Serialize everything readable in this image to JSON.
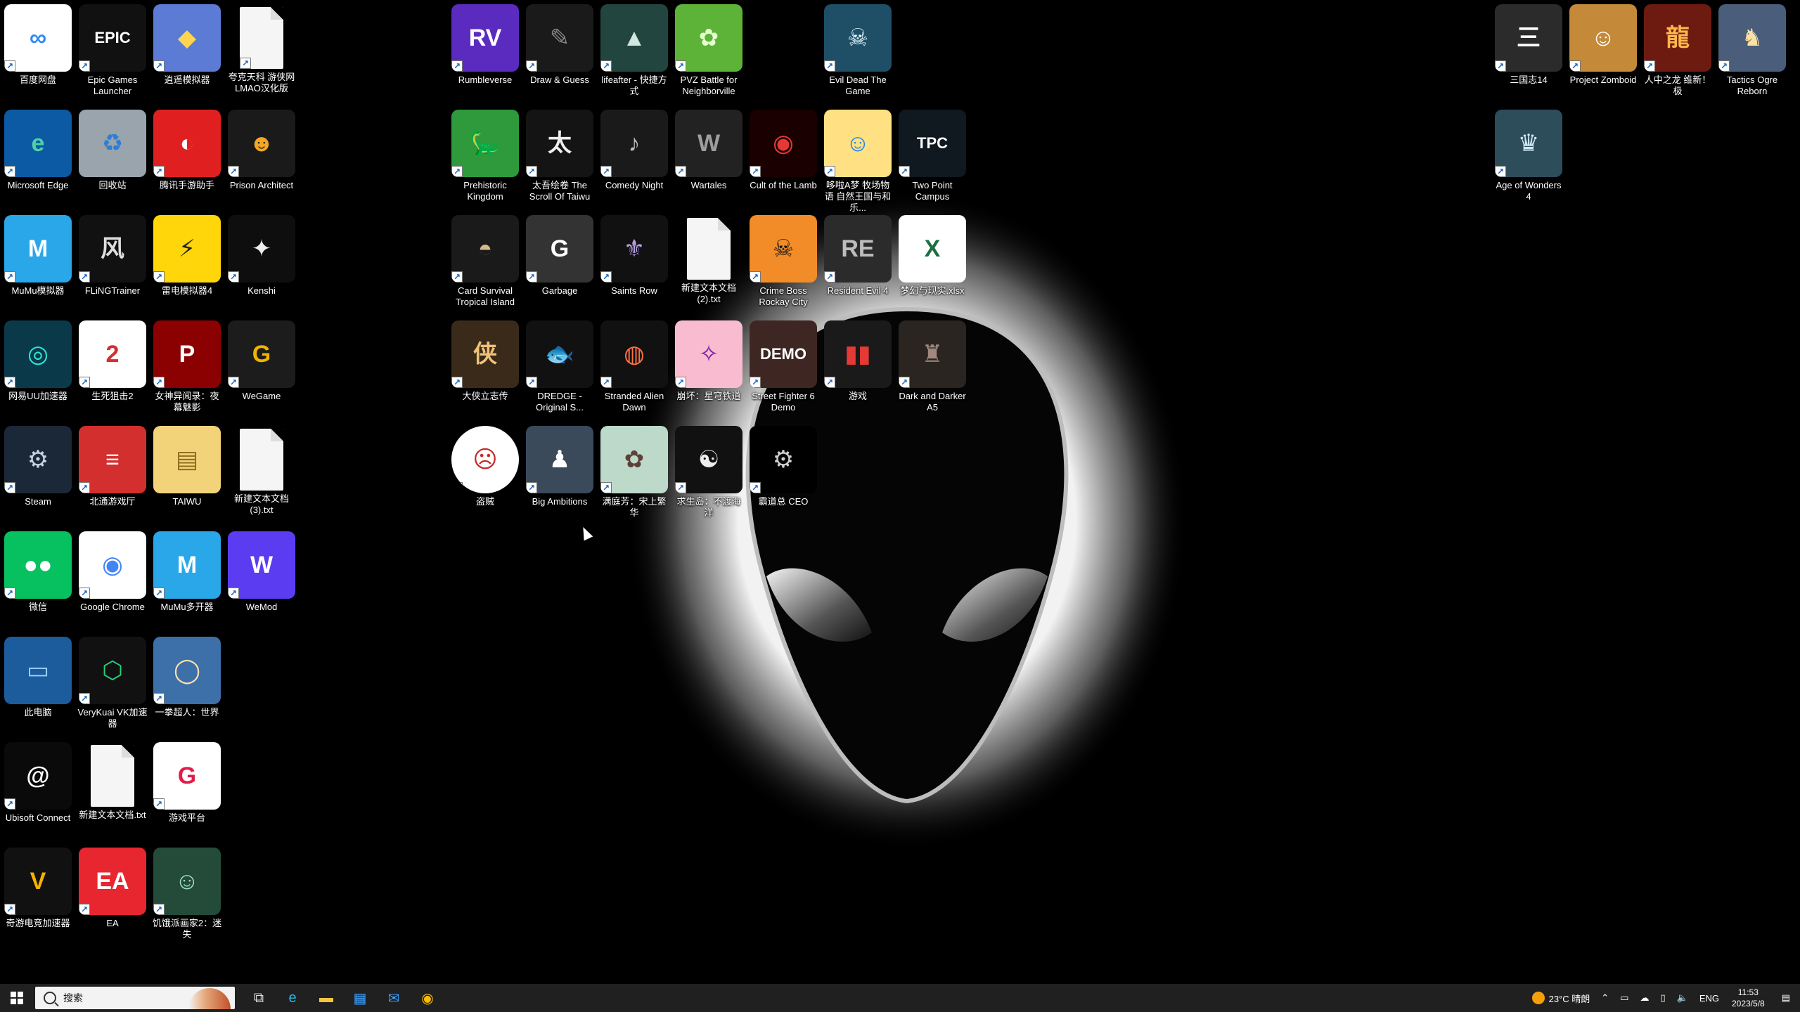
{
  "colors": {
    "taskbar": "#202020",
    "desktop_background": "#000000"
  },
  "desktop": {
    "icons": [
      {
        "label": "百度网盘",
        "icon": "baidu-netdisk-icon",
        "bg": "#ffffff",
        "fg": "#2f8cf5",
        "glyph": "∞",
        "col": 0,
        "row": 0,
        "shortcut": true
      },
      {
        "label": "Epic Games Launcher",
        "icon": "epic-games-icon",
        "bg": "#111111",
        "fg": "#ffffff",
        "glyph": "EPIC",
        "col": 1,
        "row": 0,
        "shortcut": true
      },
      {
        "label": "逍遥模拟器",
        "icon": "xiaoyao-emulator-icon",
        "bg": "#5b7bd5",
        "fg": "#ffd54f",
        "glyph": "◆",
        "col": 2,
        "row": 0,
        "shortcut": true
      },
      {
        "label": "夸克天科 游侠网LMAO汉化版",
        "icon": "document-icon",
        "bg": "doc",
        "fg": "#333333",
        "glyph": "",
        "col": 3,
        "row": 0,
        "shortcut": true
      },
      {
        "label": "Microsoft Edge",
        "icon": "edge-icon",
        "bg": "#0c59a4",
        "fg": "#4fd1a5",
        "glyph": "e",
        "col": 0,
        "row": 1,
        "shortcut": true
      },
      {
        "label": "回收站",
        "icon": "recycle-bin-icon",
        "bg": "#9aa4ad",
        "fg": "#2e7dd1",
        "glyph": "♻",
        "col": 1,
        "row": 1,
        "shortcut": false
      },
      {
        "label": "腾讯手游助手",
        "icon": "tencent-mobile-assistant-icon",
        "bg": "#e02020",
        "fg": "#ffffff",
        "glyph": "◐",
        "col": 2,
        "row": 1,
        "shortcut": true
      },
      {
        "label": "Prison Architect",
        "icon": "prison-architect-icon",
        "bg": "#1a1a1a",
        "fg": "#f5a623",
        "glyph": "☻",
        "col": 3,
        "row": 1,
        "shortcut": true
      },
      {
        "label": "MuMu模拟器",
        "icon": "mumu-emulator-icon",
        "bg": "#2aa7e8",
        "fg": "#ffffff",
        "glyph": "M",
        "col": 0,
        "row": 2,
        "shortcut": true
      },
      {
        "label": "FLiNGTrainer",
        "icon": "fling-trainer-icon",
        "bg": "#111111",
        "fg": "#dddddd",
        "glyph": "风",
        "col": 1,
        "row": 2,
        "shortcut": true
      },
      {
        "label": "雷电模拟器4",
        "icon": "ldplayer-icon",
        "bg": "#ffd60a",
        "fg": "#222222",
        "glyph": "⚡",
        "col": 2,
        "row": 2,
        "shortcut": true
      },
      {
        "label": "Kenshi",
        "icon": "kenshi-icon",
        "bg": "#0e0e0e",
        "fg": "#eeeeee",
        "glyph": "✦",
        "col": 3,
        "row": 2,
        "shortcut": true
      },
      {
        "label": "网易UU加速器",
        "icon": "uu-accelerator-icon",
        "bg": "#0a3a4a",
        "fg": "#2ee6d6",
        "glyph": "◎",
        "col": 0,
        "row": 3,
        "shortcut": true
      },
      {
        "label": "生死狙击2",
        "icon": "game-icon",
        "bg": "#ffffff",
        "fg": "#d32f2f",
        "glyph": "2",
        "col": 1,
        "row": 3,
        "shortcut": true
      },
      {
        "label": "女神异闻录：夜幕魅影",
        "icon": "persona-icon",
        "bg": "#8b0000",
        "fg": "#ffffff",
        "glyph": "P",
        "col": 2,
        "row": 3,
        "shortcut": true
      },
      {
        "label": "WeGame",
        "icon": "wegame-icon",
        "bg": "#1c1c1c",
        "fg": "#f0b400",
        "glyph": "G",
        "col": 3,
        "row": 3,
        "shortcut": true
      },
      {
        "label": "Steam",
        "icon": "steam-icon",
        "bg": "#1b2838",
        "fg": "#c7d5e0",
        "glyph": "⚙",
        "col": 0,
        "row": 4,
        "shortcut": true
      },
      {
        "label": "北通游戏厅",
        "icon": "game-hall-icon",
        "bg": "#d32f2f",
        "fg": "#ffffff",
        "glyph": "≡",
        "col": 1,
        "row": 4,
        "shortcut": true
      },
      {
        "label": "TAIWU",
        "icon": "folder-icon",
        "bg": "#f2d37a",
        "fg": "#8a6d1d",
        "glyph": "▤",
        "col": 2,
        "row": 4,
        "shortcut": false
      },
      {
        "label": "新建文本文档 (3).txt",
        "icon": "text-file-icon",
        "bg": "doc",
        "fg": "#333333",
        "glyph": "",
        "col": 3,
        "row": 4,
        "shortcut": false
      },
      {
        "label": "微信",
        "icon": "wechat-icon",
        "bg": "#07c160",
        "fg": "#ffffff",
        "glyph": "●●",
        "col": 0,
        "row": 5,
        "shortcut": true
      },
      {
        "label": "Google Chrome",
        "icon": "chrome-icon",
        "bg": "#ffffff",
        "fg": "#4285f4",
        "glyph": "◉",
        "col": 1,
        "row": 5,
        "shortcut": true
      },
      {
        "label": "MuMu多开器",
        "icon": "mumu-multi-icon",
        "bg": "#2aa7e8",
        "fg": "#ffffff",
        "glyph": "M",
        "col": 2,
        "row": 5,
        "shortcut": true
      },
      {
        "label": "WeMod",
        "icon": "wemod-icon",
        "bg": "#5b3cf0",
        "fg": "#ffffff",
        "glyph": "W",
        "col": 3,
        "row": 5,
        "shortcut": true
      },
      {
        "label": "此电脑",
        "icon": "this-pc-icon",
        "bg": "#1c5b9c",
        "fg": "#9fd3ff",
        "glyph": "▭",
        "col": 0,
        "row": 6,
        "shortcut": false
      },
      {
        "label": "VeryKuai VK加速器",
        "icon": "verykuai-icon",
        "bg": "#111111",
        "fg": "#22d37a",
        "glyph": "⬡",
        "col": 1,
        "row": 6,
        "shortcut": true
      },
      {
        "label": "一拳超人：世界",
        "icon": "one-punch-man-icon",
        "bg": "#3d6fa8",
        "fg": "#ffe0b2",
        "glyph": "◯",
        "col": 2,
        "row": 6,
        "shortcut": true
      },
      {
        "label": "Ubisoft Connect",
        "icon": "ubisoft-icon",
        "bg": "#0a0a0a",
        "fg": "#ffffff",
        "glyph": "@",
        "col": 0,
        "row": 7,
        "shortcut": true
      },
      {
        "label": "新建文本文档.txt",
        "icon": "text-file-icon",
        "bg": "doc",
        "fg": "#333333",
        "glyph": "",
        "col": 1,
        "row": 7,
        "shortcut": false
      },
      {
        "label": "游戏平台",
        "icon": "game-platform-icon",
        "bg": "#ffffff",
        "fg": "#e11d48",
        "glyph": "G",
        "col": 2,
        "row": 7,
        "shortcut": true
      },
      {
        "label": "奇游电竞加速器",
        "icon": "qiyou-accelerator-icon",
        "bg": "#111111",
        "fg": "#f5b301",
        "glyph": "V",
        "col": 0,
        "row": 8,
        "shortcut": true
      },
      {
        "label": "EA",
        "icon": "ea-icon",
        "bg": "#e8262f",
        "fg": "#ffffff",
        "glyph": "EA",
        "col": 1,
        "row": 8,
        "shortcut": true
      },
      {
        "label": "饥饿派画家2：迷失",
        "icon": "painter-game-icon",
        "bg": "#244a3a",
        "fg": "#9be3c9",
        "glyph": "☺",
        "col": 2,
        "row": 8,
        "shortcut": true
      },
      {
        "label": "Rumbleverse",
        "icon": "rumbleverse-icon",
        "bg": "#5b2bbf",
        "fg": "#ffffff",
        "glyph": "RV",
        "col": 6,
        "row": 0,
        "shortcut": true
      },
      {
        "label": "Draw & Guess",
        "icon": "draw-guess-icon",
        "bg": "#1a1a1a",
        "fg": "#888888",
        "glyph": "✎",
        "col": 7,
        "row": 0,
        "shortcut": true
      },
      {
        "label": "lifeafter - 快捷方式",
        "icon": "lifeafter-icon",
        "bg": "#22463f",
        "fg": "#cfe8e0",
        "glyph": "▲",
        "col": 8,
        "row": 0,
        "shortcut": true
      },
      {
        "label": "PVZ Battle for Neighborville",
        "icon": "pvz-icon",
        "bg": "#5cb338",
        "fg": "#e8ffd0",
        "glyph": "✿",
        "col": 9,
        "row": 0,
        "shortcut": true
      },
      {
        "label": "Evil Dead The Game",
        "icon": "evil-dead-icon",
        "bg": "#1e4f66",
        "fg": "#dff6ff",
        "glyph": "☠",
        "col": 11,
        "row": 0,
        "shortcut": true
      },
      {
        "label": "Prehistoric Kingdom",
        "icon": "prehistoric-kingdom-icon",
        "bg": "#2e9a3c",
        "fg": "#ffffff",
        "glyph": "🦕",
        "col": 6,
        "row": 1,
        "shortcut": true
      },
      {
        "label": "太吾绘卷 The Scroll Of Taiwu",
        "icon": "taiwu-icon",
        "bg": "#141414",
        "fg": "#eeeeee",
        "glyph": "太",
        "col": 7,
        "row": 1,
        "shortcut": true
      },
      {
        "label": "Comedy Night",
        "icon": "comedy-night-icon",
        "bg": "#1a1a1a",
        "fg": "#bbbbbb",
        "glyph": "♪",
        "col": 8,
        "row": 1,
        "shortcut": true
      },
      {
        "label": "Wartales",
        "icon": "wartales-icon",
        "bg": "#222222",
        "fg": "#9e9e9e",
        "glyph": "W",
        "col": 9,
        "row": 1,
        "shortcut": true
      },
      {
        "label": "Cult of the Lamb",
        "icon": "cult-of-the-lamb-icon",
        "bg": "#1a0000",
        "fg": "#e53935",
        "glyph": "◉",
        "col": 10,
        "row": 1,
        "shortcut": true
      },
      {
        "label": "哆啦A梦 牧场物语 自然王国与和乐...",
        "icon": "doraemon-icon",
        "bg": "#ffe082",
        "fg": "#1e88e5",
        "glyph": "☺",
        "col": 11,
        "row": 1,
        "shortcut": true
      },
      {
        "label": "Two Point Campus",
        "icon": "two-point-campus-icon",
        "bg": "#101820",
        "fg": "#ffffff",
        "glyph": "TPC",
        "col": 12,
        "row": 1,
        "shortcut": true
      },
      {
        "label": "Card Survival Tropical Island",
        "icon": "card-survival-icon",
        "bg": "#1a1a1a",
        "fg": "#d7b98e",
        "glyph": "◓",
        "col": 6,
        "row": 2,
        "shortcut": true
      },
      {
        "label": "Garbage",
        "icon": "garbage-icon",
        "bg": "#333333",
        "fg": "#ffffff",
        "glyph": "G",
        "col": 7,
        "row": 2,
        "shortcut": true
      },
      {
        "label": "Saints Row",
        "icon": "saints-row-icon",
        "bg": "#111111",
        "fg": "#b39ddb",
        "glyph": "⚜",
        "col": 8,
        "row": 2,
        "shortcut": true
      },
      {
        "label": "新建文本文档 (2).txt",
        "icon": "text-file-icon",
        "bg": "doc",
        "fg": "#333333",
        "glyph": "",
        "col": 9,
        "row": 2,
        "shortcut": false
      },
      {
        "label": "Crime Boss Rockay City",
        "icon": "crime-boss-icon",
        "bg": "#f28c28",
        "fg": "#1a1a1a",
        "glyph": "☠",
        "col": 10,
        "row": 2,
        "shortcut": true
      },
      {
        "label": "Resident Evil 4",
        "icon": "resident-evil-4-icon",
        "bg": "#2b2b2b",
        "fg": "#bdbdbd",
        "glyph": "RE",
        "col": 11,
        "row": 2,
        "shortcut": true
      },
      {
        "label": "梦幻与现实.xlsx",
        "icon": "excel-file-icon",
        "bg": "#ffffff",
        "fg": "#1d6f42",
        "glyph": "X",
        "col": 12,
        "row": 2,
        "shortcut": false
      },
      {
        "label": "大侠立志传",
        "icon": "hero-game-icon",
        "bg": "#3a2a1a",
        "fg": "#f0c27b",
        "glyph": "侠",
        "col": 6,
        "row": 3,
        "shortcut": true
      },
      {
        "label": "DREDGE - Original S...",
        "icon": "dredge-icon",
        "bg": "#111111",
        "fg": "#eeeeee",
        "glyph": "🐟",
        "col": 7,
        "row": 3,
        "shortcut": true
      },
      {
        "label": "Stranded Alien Dawn",
        "icon": "stranded-alien-dawn-icon",
        "bg": "#111111",
        "fg": "#ff7043",
        "glyph": "◍",
        "col": 8,
        "row": 3,
        "shortcut": true
      },
      {
        "label": "崩坏：星穹铁道",
        "icon": "honkai-star-rail-icon",
        "bg": "#f8bbd0",
        "fg": "#7b1fa2",
        "glyph": "✧",
        "col": 9,
        "row": 3,
        "shortcut": true
      },
      {
        "label": "Street Fighter 6 Demo",
        "icon": "street-fighter-6-icon",
        "bg": "#3e2723",
        "fg": "#ffffff",
        "glyph": "DEMO",
        "col": 10,
        "row": 3,
        "shortcut": true
      },
      {
        "label": "游戏",
        "icon": "game-icon",
        "bg": "#1a1a1a",
        "fg": "#e53935",
        "glyph": "▮▮",
        "col": 11,
        "row": 3,
        "shortcut": true
      },
      {
        "label": "Dark and Darker A5",
        "icon": "dark-and-darker-icon",
        "bg": "#2a2520",
        "fg": "#a1887f",
        "glyph": "♜",
        "col": 12,
        "row": 3,
        "shortcut": true
      },
      {
        "label": "盗贼",
        "icon": "bandit-game-icon",
        "bg": "#ffffff",
        "fg": "#c62828",
        "glyph": "☹",
        "col": 6,
        "row": 4,
        "shortcut": true,
        "round": true
      },
      {
        "label": "Big Ambitions",
        "icon": "big-ambitions-icon",
        "bg": "#3b4a5a",
        "fg": "#ffffff",
        "glyph": "♟",
        "col": 7,
        "row": 4,
        "shortcut": true
      },
      {
        "label": "满庭芳：宋上繁华",
        "icon": "song-dynasty-game-icon",
        "bg": "#bcd9c9",
        "fg": "#5d4037",
        "glyph": "✿",
        "col": 8,
        "row": 4,
        "shortcut": true
      },
      {
        "label": "求生岛：不渡海洋",
        "icon": "survival-island-icon",
        "bg": "#111111",
        "fg": "#eeeeee",
        "glyph": "☯",
        "col": 9,
        "row": 4,
        "shortcut": true
      },
      {
        "label": "霸道总 CEO",
        "icon": "settings-gear-icon",
        "bg": "#000000",
        "fg": "#cfcfcf",
        "glyph": "⚙",
        "col": 10,
        "row": 4,
        "shortcut": true
      },
      {
        "label": "三国志14",
        "icon": "romance-three-kingdoms-icon",
        "bg": "#2b2b2b",
        "fg": "#ffffff",
        "glyph": "三",
        "col": 20,
        "row": 0,
        "shortcut": true
      },
      {
        "label": "Project Zomboid",
        "icon": "project-zomboid-icon",
        "bg": "#c48a3a",
        "fg": "#ffffff",
        "glyph": "☺",
        "col": 21,
        "row": 0,
        "shortcut": true
      },
      {
        "label": "人中之龙 维新！极",
        "icon": "yakuza-ishin-icon",
        "bg": "#6d1b10",
        "fg": "#ffb74d",
        "glyph": "龍",
        "col": 22,
        "row": 0,
        "shortcut": true
      },
      {
        "label": "Tactics Ogre Reborn",
        "icon": "tactics-ogre-icon",
        "bg": "#4a5d7a",
        "fg": "#ffe0a3",
        "glyph": "♞",
        "col": 23,
        "row": 0,
        "shortcut": true
      },
      {
        "label": "Age of Wonders 4",
        "icon": "age-of-wonders-icon",
        "bg": "#2e4d5a",
        "fg": "#cfe7ff",
        "glyph": "♛",
        "col": 20,
        "row": 1,
        "shortcut": true
      }
    ]
  },
  "taskbar": {
    "search_placeholder": "搜索",
    "apps": [
      {
        "name": "task-view-icon",
        "glyph": "⧉",
        "color": "#dddddd"
      },
      {
        "name": "edge-icon",
        "glyph": "e",
        "color": "#2fb6e8"
      },
      {
        "name": "file-explorer-icon",
        "glyph": "▬",
        "color": "#f5c542"
      },
      {
        "name": "store-icon",
        "glyph": "▦",
        "color": "#3aa0ff"
      },
      {
        "name": "mail-icon",
        "glyph": "✉",
        "color": "#3aa0ff"
      },
      {
        "name": "chrome-icon",
        "glyph": "◉",
        "color": "#fbbc04"
      }
    ],
    "weather": "23°C 晴朗",
    "language": "ENG",
    "time": "11:53",
    "date": "2023/5/8"
  }
}
